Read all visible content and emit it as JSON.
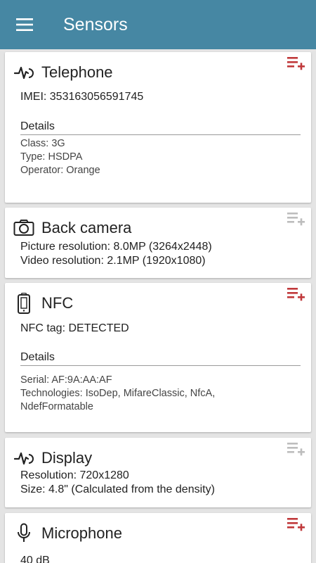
{
  "app": {
    "title": "Sensors",
    "menu_icon": "hamburger-menu-icon"
  },
  "colors": {
    "appbar": "#4687a3",
    "add_active": "#c0393b",
    "add_inactive": "#bdbdbd"
  },
  "cards": [
    {
      "title": "Telephone",
      "icon": "pulse-icon",
      "add_active": true,
      "lines": [
        "IMEI: 353163056591745"
      ],
      "details_label": "Details",
      "details": [
        "Class: 3G",
        "Type: HSDPA",
        "Operator: Orange"
      ]
    },
    {
      "title": "Back camera",
      "icon": "camera-icon",
      "add_active": false,
      "lines": [
        "Picture resolution: 8.0MP (3264x2448)",
        "Video resolution: 2.1MP (1920x1080)"
      ]
    },
    {
      "title": "NFC",
      "icon": "nfc-phone-icon",
      "add_active": true,
      "lines": [
        "NFC tag: DETECTED"
      ],
      "details_label": "Details",
      "details": [
        "Serial: AF:9A:AA:AF",
        "Technologies: IsoDep, MifareClassic, NfcA, NdefFormatable"
      ]
    },
    {
      "title": "Display",
      "icon": "pulse-icon",
      "add_active": false,
      "lines": [
        "Resolution: 720x1280",
        "Size: 4.8\" (Calculated from the density)"
      ]
    },
    {
      "title": "Microphone",
      "icon": "microphone-icon",
      "add_active": true,
      "lines": [
        "40 dB"
      ]
    }
  ]
}
